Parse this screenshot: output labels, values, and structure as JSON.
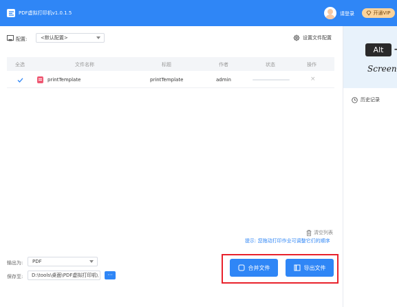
{
  "titlebar": {
    "app_title": "PDF虚拟打印机v1.0.1.5",
    "login": "请登录",
    "vip": "开通VIP"
  },
  "config": {
    "label": "配置:",
    "selected": "<默认配置>",
    "file_config": "设置文件配置"
  },
  "table": {
    "headers": [
      "全选",
      "文件名称",
      "标题",
      "作者",
      "状态",
      "操作"
    ],
    "rows": [
      {
        "checked": true,
        "file_name": "printTemplate",
        "title": "printTemplate",
        "author": "admin",
        "progress": 0,
        "action": "×"
      }
    ]
  },
  "bottom": {
    "clear_list": "清空列表",
    "hint": "提示: 您拖动打印作业可调整它们的顺序",
    "output_label": "输出为:",
    "output_value": "PDF",
    "save_label": "保存至:",
    "save_path": "D:\\tools\\桌面\\PDF虚拟打印机\\",
    "browse": "···",
    "merge": "合并文件",
    "export": "导出文件"
  },
  "right_panel": {
    "promo_key": "Alt",
    "promo_plus": "+",
    "promo_word": "Screen",
    "history": "历史记录"
  },
  "colors": {
    "accent": "#2f86f6",
    "highlight_border": "#e8212b",
    "vip": "#fbd39a"
  }
}
